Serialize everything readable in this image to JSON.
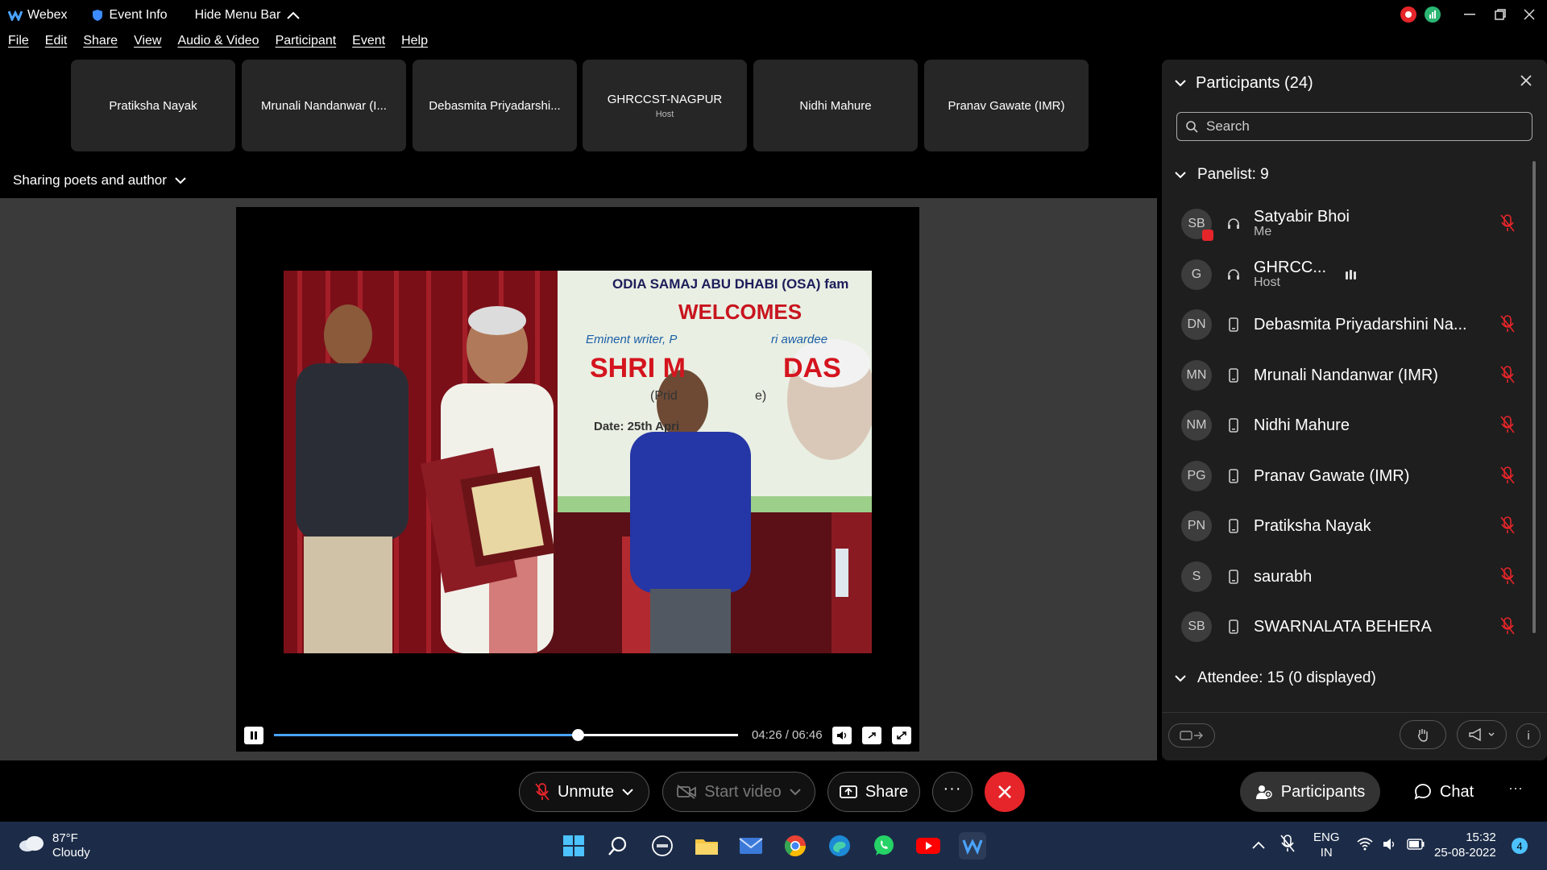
{
  "titlebar": {
    "app_name": "Webex",
    "event_info": "Event Info",
    "hide_menu_bar": "Hide Menu Bar"
  },
  "menu": [
    "File",
    "Edit",
    "Share",
    "View",
    "Audio & Video",
    "Participant",
    "Event",
    "Help"
  ],
  "tiles": [
    {
      "name": "Pratiksha Nayak",
      "sub": ""
    },
    {
      "name": "Mrunali Nandanwar (I...",
      "sub": ""
    },
    {
      "name": "Debasmita Priyadarshi...",
      "sub": ""
    },
    {
      "name": "GHRCCST-NAGPUR",
      "sub": "Host"
    },
    {
      "name": "Nidhi Mahure",
      "sub": ""
    },
    {
      "name": "Pranav Gawate (IMR)",
      "sub": ""
    }
  ],
  "sharing_label": "Sharing poets and author",
  "photo_banner": {
    "line1": "ODIA SAMAJ ABU DHABI (OSA) fam",
    "line2": "WELCOMES",
    "line3": "Eminent writer, P",
    "line3b": "ri awardee",
    "line4": "SHRI M",
    "line4b": "DAS",
    "line5": "(Prid",
    "line5b": "e)",
    "line6": "Date: 25th Apri"
  },
  "player": {
    "time": "04:26 / 06:46",
    "progress": 0.655
  },
  "toolbar": {
    "unmute": "Unmute",
    "start_video": "Start video",
    "share": "Share",
    "participants": "Participants",
    "chat": "Chat"
  },
  "panel": {
    "title": "Participants (24)",
    "search_placeholder": "Search",
    "panelist_header": "Panelist: 9",
    "attendee_header": "Attendee: 15 (0 displayed)",
    "panelists": [
      {
        "initials": "SB",
        "name": "Satyabir Bhoi",
        "role": "Me",
        "device": "headset"
      },
      {
        "initials": "G",
        "name": "GHRCC...",
        "role": "Host",
        "device": "headset"
      },
      {
        "initials": "DN",
        "name": "Debasmita Priyadarshini Na...",
        "role": "",
        "device": "phone"
      },
      {
        "initials": "MN",
        "name": "Mrunali Nandanwar (IMR)",
        "role": "",
        "device": "phone"
      },
      {
        "initials": "NM",
        "name": "Nidhi Mahure",
        "role": "",
        "device": "phone"
      },
      {
        "initials": "PG",
        "name": "Pranav Gawate (IMR)",
        "role": "",
        "device": "phone"
      },
      {
        "initials": "PN",
        "name": "Pratiksha Nayak",
        "role": "",
        "device": "phone"
      },
      {
        "initials": "S",
        "name": "saurabh",
        "role": "",
        "device": "phone"
      },
      {
        "initials": "SB",
        "name": "SWARNALATA BEHERA",
        "role": "",
        "device": "phone"
      }
    ]
  },
  "taskbar": {
    "weather_temp": "87°F",
    "weather_desc": "Cloudy",
    "lang1": "ENG",
    "lang2": "IN",
    "time": "15:32",
    "date": "25-08-2022",
    "notif_count": "4"
  },
  "colors": {
    "accent_red": "#e5252a",
    "progress_blue": "#4aa3ff",
    "panel_bg": "#1e1e1e",
    "taskbar_bg": "#1c2c48"
  }
}
